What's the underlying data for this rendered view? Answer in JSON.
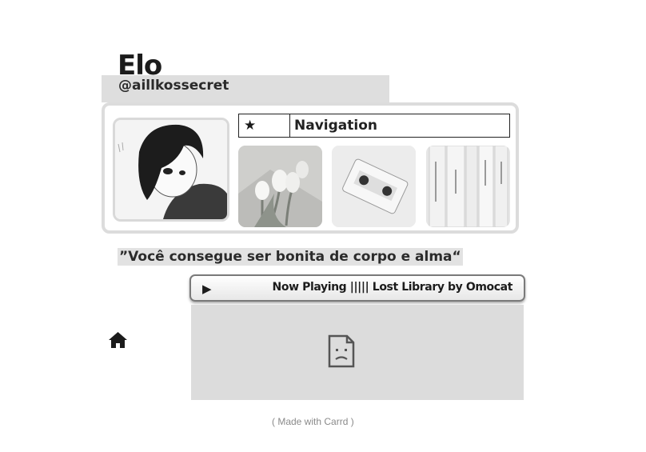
{
  "profile": {
    "name": "Elo",
    "handle": "@aillkossecret"
  },
  "nav": {
    "star": "★",
    "label": "Navigation"
  },
  "quote": "”Você consegue ser bonita de corpo e alma“",
  "player": {
    "play_symbol": "▶",
    "now_playing": "Now Playing ||||| Lost Library by Omocat"
  },
  "footer": "( Made with Carrd )",
  "icons": {
    "home": "home-icon",
    "broken_embed": "broken-document-icon"
  },
  "colors": {
    "accent_gray": "#dedede",
    "text": "#1a1a1a"
  }
}
